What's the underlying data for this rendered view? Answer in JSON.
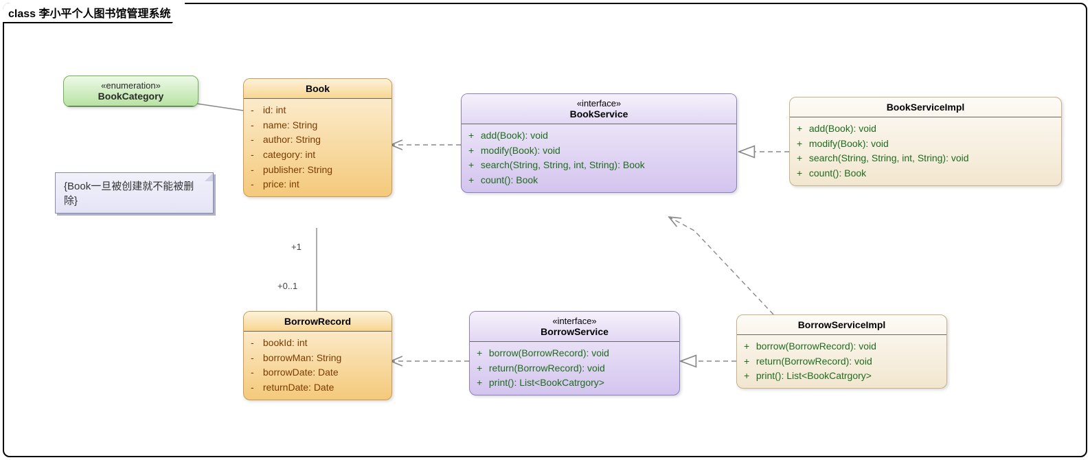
{
  "frameTitle": "class 李小平个人图书馆管理系统",
  "note": {
    "text": "{Book一旦被创建就不能被删除}"
  },
  "mult": {
    "bookEnd": "+1",
    "borrowEnd": "+0..1"
  },
  "nodes": {
    "bookCategory": {
      "stereo": "«enumeration»",
      "name": "BookCategory"
    },
    "book": {
      "name": "Book",
      "attrs": [
        {
          "vis": "-",
          "sig": "id: int"
        },
        {
          "vis": "-",
          "sig": "name: String"
        },
        {
          "vis": "-",
          "sig": "author: String"
        },
        {
          "vis": "-",
          "sig": "category: int"
        },
        {
          "vis": "-",
          "sig": "publisher: String"
        },
        {
          "vis": "-",
          "sig": "price: int"
        }
      ]
    },
    "bookService": {
      "stereo": "«interface»",
      "name": "BookService",
      "ops": [
        {
          "vis": "+",
          "sig": "add(Book): void"
        },
        {
          "vis": "+",
          "sig": "modify(Book): void"
        },
        {
          "vis": "+",
          "sig": "search(String, String, int, String): Book"
        },
        {
          "vis": "+",
          "sig": "count(): Book"
        }
      ]
    },
    "bookServiceImpl": {
      "name": "BookServiceImpl",
      "ops": [
        {
          "vis": "+",
          "sig": "add(Book): void"
        },
        {
          "vis": "+",
          "sig": "modify(Book): void"
        },
        {
          "vis": "+",
          "sig": "search(String, String, int, String): void"
        },
        {
          "vis": "+",
          "sig": "count(): Book"
        }
      ]
    },
    "borrowRecord": {
      "name": "BorrowRecord",
      "attrs": [
        {
          "vis": "-",
          "sig": "bookId: int"
        },
        {
          "vis": "-",
          "sig": "borrowMan: String"
        },
        {
          "vis": "-",
          "sig": "borrowDate: Date"
        },
        {
          "vis": "-",
          "sig": "returnDate: Date"
        }
      ]
    },
    "borrowService": {
      "stereo": "«interface»",
      "name": "BorrowService",
      "ops": [
        {
          "vis": "+",
          "sig": "borrow(BorrowRecord): void"
        },
        {
          "vis": "+",
          "sig": "return(BorrowRecord): void"
        },
        {
          "vis": "+",
          "sig": "print(): List<BookCatrgory>"
        }
      ]
    },
    "borrowServiceImpl": {
      "name": "BorrowServiceImpl",
      "ops": [
        {
          "vis": "+",
          "sig": "borrow(BorrowRecord): void"
        },
        {
          "vis": "+",
          "sig": "return(BorrowRecord): void"
        },
        {
          "vis": "+",
          "sig": "print(): List<BookCatrgory>"
        }
      ]
    }
  }
}
